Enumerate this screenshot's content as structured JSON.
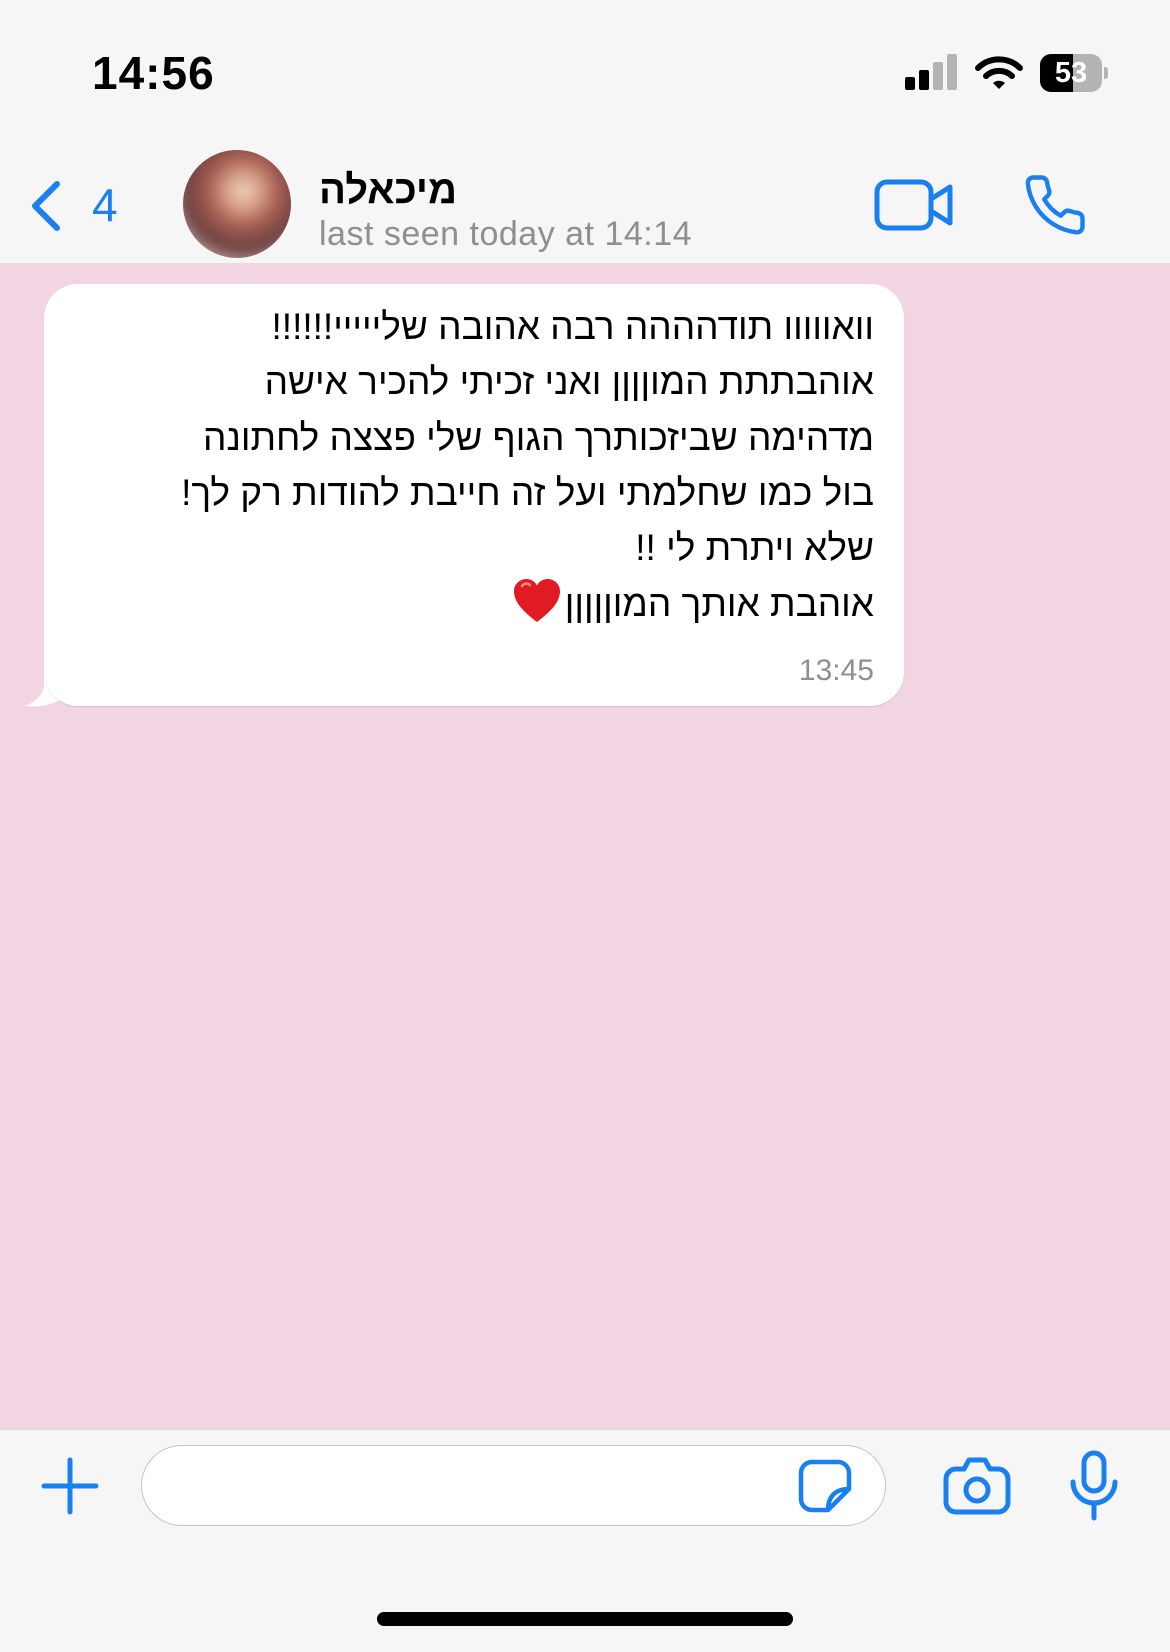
{
  "status_bar": {
    "time": "14:56",
    "battery_level": "53",
    "battery_fraction": 0.53,
    "signal_bars_active": 3,
    "signal_bars_total": 4,
    "icons": [
      "cellular-signal-icon",
      "wifi-icon",
      "battery-icon"
    ]
  },
  "header": {
    "back_count": "4",
    "contact_name": "מיכאלה",
    "last_seen": "last seen today at 14:14",
    "icons": [
      "back-chevron-icon",
      "video-call-icon",
      "phone-call-icon"
    ]
  },
  "message": {
    "direction": "incoming",
    "lines": [
      "וואווווו תודהההה רבה אהובה שלייייי!!!!!!",
      "אוהבתתת המוןןןן ואני זכיתי להכיר אישה",
      "מדהימה שביזכותרך הגוף שלי פצצה לחתונה",
      "בול כמו שחלמתי ועל זה חייבת להודות רק לך!",
      "שלא ויתרת לי !!",
      "אוהבת אותך המוןןןןן"
    ],
    "trailing_emoji": "red-heart-icon",
    "time": "13:45"
  },
  "input_bar": {
    "icons": [
      "plus-icon",
      "sticker-icon",
      "camera-icon",
      "microphone-icon"
    ]
  },
  "colors": {
    "accent": "#1a7ff0",
    "chat_background": "#f2d5e2",
    "bubble": "#ffffff",
    "secondary_text": "#8e8e93",
    "bar_background": "#f6f6f6"
  }
}
